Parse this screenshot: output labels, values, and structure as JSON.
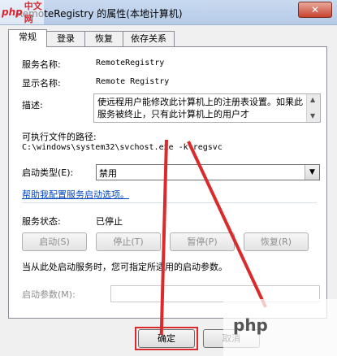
{
  "window": {
    "title": "RemoteRegistry 的属性(本地计算机)",
    "close_glyph": "✕",
    "logo_php": "php",
    "logo_cn": "中文网"
  },
  "tabs": [
    {
      "label": "常规",
      "active": true
    },
    {
      "label": "登录",
      "active": false
    },
    {
      "label": "恢复",
      "active": false
    },
    {
      "label": "依存关系",
      "active": false
    }
  ],
  "general": {
    "service_name_label": "服务名称:",
    "service_name_value": "RemoteRegistry",
    "display_name_label": "显示名称:",
    "display_name_value": "Remote Registry",
    "description_label": "描述:",
    "description_value": "使远程用户能修改此计算机上的注册表设置。如果此服务被终止，只有此计算机上的用户才",
    "exe_path_label": "可执行文件的路径:",
    "exe_path_value": "C:\\windows\\system32\\svchost.exe -k regsvc",
    "startup_type_label": "启动类型(E):",
    "startup_type_value": "禁用",
    "help_link": "帮助我配置服务启动选项。",
    "service_status_label": "服务状态:",
    "service_status_value": "已停止",
    "start_button": "启动(S)",
    "stop_button": "停止(T)",
    "pause_button": "暂停(P)",
    "resume_button": "恢复(R)",
    "hint_text": "当从此处启动服务时，您可指定所适用的启动参数。",
    "start_params_label": "启动参数(M):",
    "start_params_value": ""
  },
  "footer": {
    "ok_button": "确定",
    "cancel_button": "取消"
  },
  "watermark": {
    "text": "php"
  },
  "colors": {
    "annotation_red": "#d92b2b",
    "link_blue": "#0047c2",
    "selection_blue": "#3399ff"
  }
}
